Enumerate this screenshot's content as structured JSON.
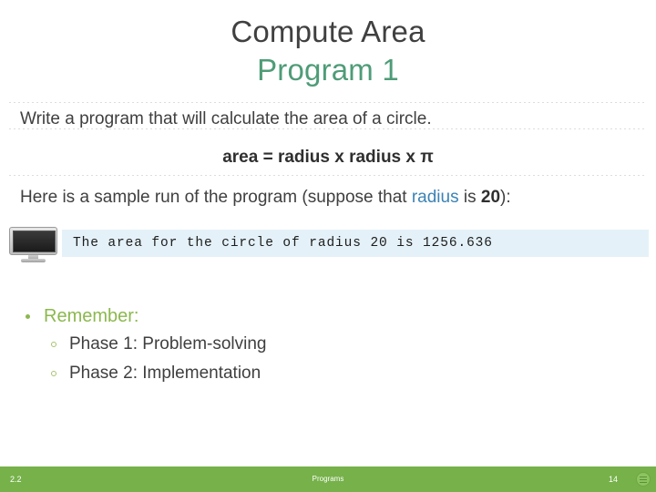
{
  "slide": {
    "title_line1": "Compute Area",
    "title_line2": "Program 1",
    "paragraph_1": "Write a program that will calculate the area of a circle.",
    "formula": "area = radius x radius x π",
    "sample_run_prefix": "Here is a sample run of the program (suppose that ",
    "sample_run_keyword": "radius",
    "sample_run_middle": " is ",
    "sample_run_value": "20",
    "sample_run_suffix": "):",
    "console_output": "The area for the circle of radius 20 is 1256.636",
    "console_icon": "monitor-icon",
    "bullets": {
      "level1_label": "Remember:",
      "level2": [
        "Phase 1: Problem-solving",
        "Phase 2: Implementation"
      ]
    }
  },
  "footer": {
    "left": "2.2",
    "center": "Programs",
    "right": "14",
    "badge_icon": "list-lines-icon"
  },
  "colors": {
    "title_dark": "#404040",
    "title_green": "#4e9c77",
    "bullet_green": "#8cb84e",
    "keyword_blue": "#3b83b5",
    "console_bg": "#e4f1f8",
    "footer_green": "#76b14a"
  }
}
